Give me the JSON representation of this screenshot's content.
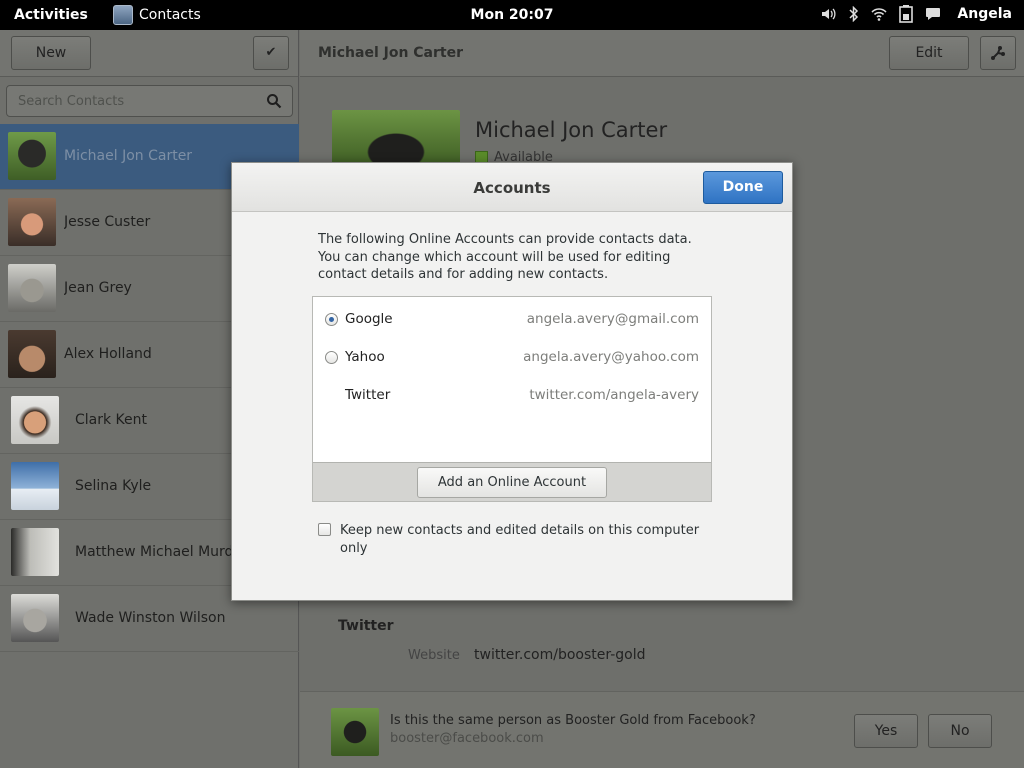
{
  "topbar": {
    "activities": "Activities",
    "app_name": "Contacts",
    "clock": "Mon 20:07",
    "user": "Angela",
    "icons": [
      "volume-icon",
      "bluetooth-icon",
      "wifi-icon",
      "battery-icon",
      "chat-icon"
    ]
  },
  "sidebar": {
    "new_label": "New",
    "select_label": "✔",
    "search_placeholder": "Search Contacts",
    "contacts": [
      {
        "name": "Michael Jon Carter",
        "selected": true
      },
      {
        "name": "Jesse Custer"
      },
      {
        "name": "Jean Grey"
      },
      {
        "name": "Alex Holland"
      },
      {
        "name": "Clark Kent"
      },
      {
        "name": "Selina Kyle"
      },
      {
        "name": "Matthew Michael Murdock"
      },
      {
        "name": "Wade Winston Wilson"
      }
    ]
  },
  "detail": {
    "toolbar_title": "Michael Jon Carter",
    "edit_label": "Edit",
    "name": "Michael Jon Carter",
    "presence": "Available",
    "section_title": "Twitter",
    "field_label": "Website",
    "field_value": "twitter.com/booster-gold"
  },
  "linkbar": {
    "question": "Is this the same person as Booster Gold from Facebook?",
    "email": "booster@facebook.com",
    "yes_label": "Yes",
    "no_label": "No"
  },
  "dialog": {
    "title": "Accounts",
    "done_label": "Done",
    "intro": "The following Online Accounts can provide contacts data. You can change which account will be used for editing contact details and for adding new contacts.",
    "accounts": [
      {
        "name": "Google",
        "value": "angela.avery@gmail.com",
        "selected": true
      },
      {
        "name": "Yahoo",
        "value": "angela.avery@yahoo.com",
        "selected": false
      },
      {
        "name": "Twitter",
        "value": "twitter.com/angela-avery"
      }
    ],
    "add_label": "Add an Online Account",
    "keep_label": "Keep new contacts and edited details on this computer only",
    "accent": "#3a7fd0"
  }
}
